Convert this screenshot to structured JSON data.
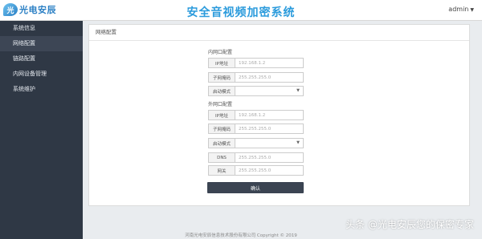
{
  "header": {
    "logo_text": "光电安辰",
    "title": "安全音视频加密系统",
    "user": "admin"
  },
  "sidebar": {
    "items": [
      {
        "label": "系统信息"
      },
      {
        "label": "网络配置"
      },
      {
        "label": "链路配置"
      },
      {
        "label": "内网设备管理"
      },
      {
        "label": "系统维护"
      }
    ]
  },
  "panel": {
    "title": "网络配置",
    "inner": {
      "section_title": "内网口配置",
      "ip_label": "IP地址",
      "ip_value": "192.168.1.2",
      "mask_label": "子网掩码",
      "mask_value": "255.255.255.0",
      "mode_label": "启动模式",
      "mode_value": ""
    },
    "outer": {
      "section_title": "外网口配置",
      "ip_label": "IP地址",
      "ip_value": "192.168.1.2",
      "mask_label": "子网掩码",
      "mask_value": "255.255.255.0",
      "mode_label": "启动模式",
      "mode_value": "",
      "dns_label": "DNS",
      "dns_value": "255.255.255.0",
      "gateway_label": "网关",
      "gateway_value": "255.255.255.0"
    },
    "confirm_label": "确认"
  },
  "footer": {
    "copyright": "河南光电安辰信息技术股份有限公司 Copyright © 2019"
  },
  "watermark": "头条 @光电安辰您的保密专家"
}
